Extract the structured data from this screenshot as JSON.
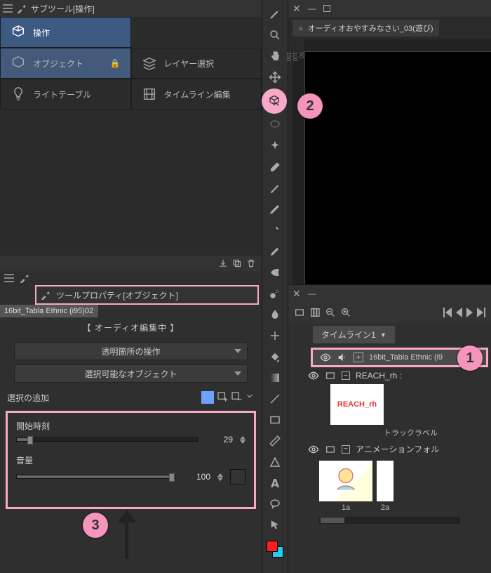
{
  "subtool": {
    "header": "サブツール[操作]",
    "tabs": [
      {
        "label": "操作",
        "icon": "cube-cursor-icon",
        "active": true
      },
      {
        "label": "",
        "icon": "",
        "active": false
      },
      {
        "label": "オブジェクト",
        "icon": "cube-cursor-icon",
        "locked": true
      },
      {
        "label": "レイヤー選択",
        "icon": "layers-icon"
      },
      {
        "label": "ライトテーブル",
        "icon": "bulb-icon"
      },
      {
        "label": "タイムライン編集",
        "icon": "film-icon"
      }
    ]
  },
  "tool_property": {
    "header": "ツールプロパティ[オブジェクト]",
    "filename": "16bit_Tabla Ethnic (i95)02",
    "editing_title": "【 オーディオ編集中 】",
    "dd1": "透明箇所の操作",
    "dd2": "選択可能なオブジェクト",
    "selection_add": "選択の追加",
    "params": {
      "start_label": "開始時刻",
      "start_value": "29",
      "volume_label": "音量",
      "volume_value": "100"
    }
  },
  "canvas": {
    "tab_title": "オーディオおやすみなさい_03(遊び)",
    "ruler_v": [
      "50",
      "100",
      "150"
    ]
  },
  "timeline": {
    "tab": "タイムライン1",
    "audio_track": "16bit_Tabla Ethnic (i9",
    "folder1": "REACH_rh :",
    "folder1_label": "トラックラベル",
    "folder2": "アニメーションフォル",
    "thumb1_text": "REACH_rh",
    "frames": [
      "1a",
      "2a"
    ]
  },
  "annotations": {
    "n1": "1",
    "n2": "2",
    "n3": "3"
  }
}
